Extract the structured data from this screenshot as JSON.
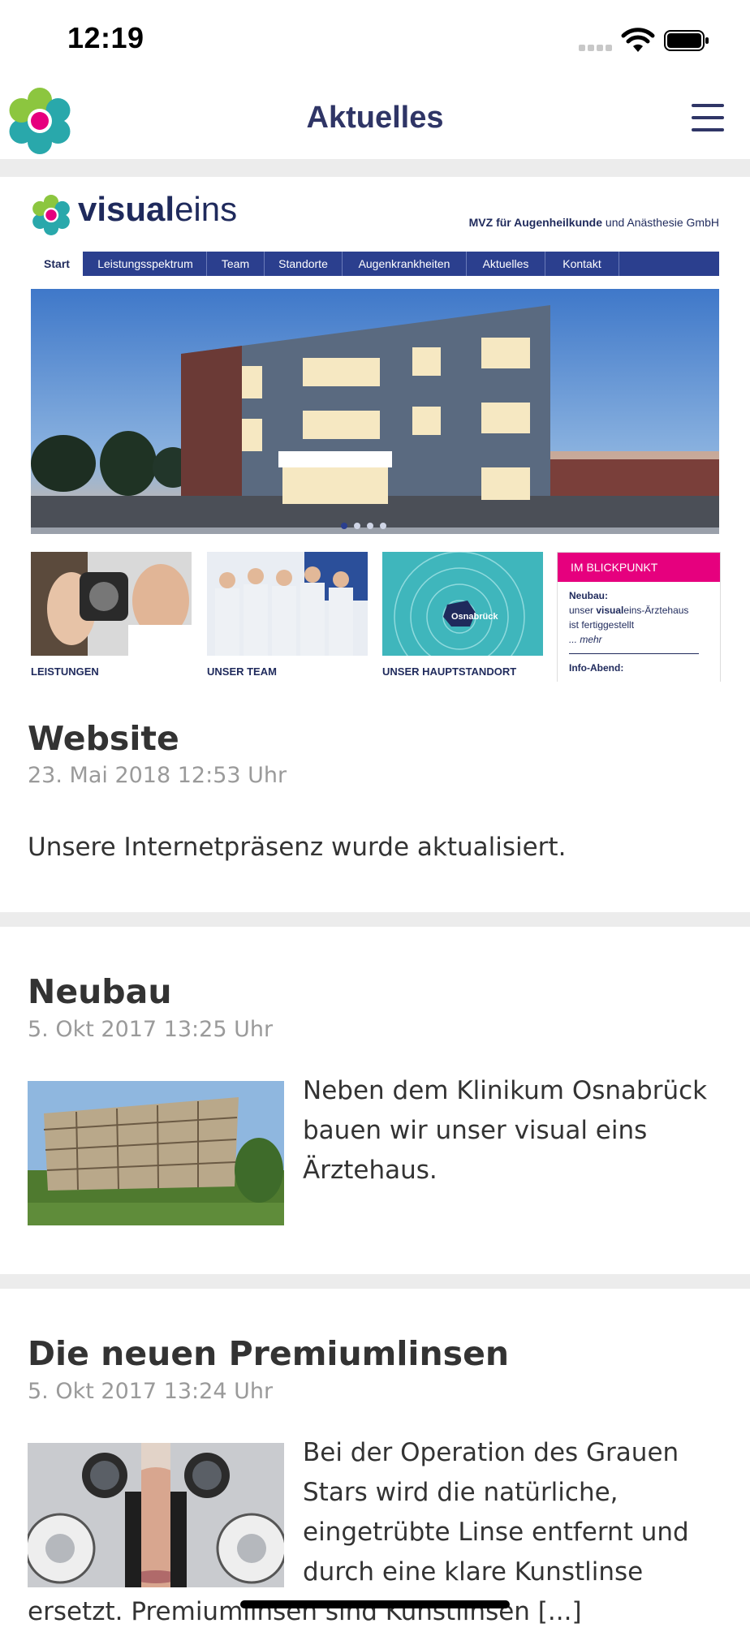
{
  "status_bar": {
    "time": "12:19"
  },
  "nav": {
    "title": "Aktuelles"
  },
  "website_preview": {
    "brand_bold": "visual",
    "brand_light": "eins",
    "tagline_bold": "MVZ für Augenheilkunde",
    "tagline_rest": " und Anästhesie GmbH",
    "menu": [
      "Start",
      "Leistungsspektrum",
      "Team",
      "Standorte",
      "Augenkrankheiten",
      "Aktuelles",
      "Kontakt"
    ],
    "tiles": [
      "LEISTUNGEN",
      "UNSER TEAM",
      "UNSER HAUPTSTANDORT"
    ],
    "map_city": "Osnabrück",
    "blickpunkt": {
      "header": "IM BLICKPUNKT",
      "item1_title": "Neubau:",
      "item1_line1_pre": "unser ",
      "item1_line1_bold": "visual",
      "item1_line1_post": "eins-Ärztehaus",
      "item1_line2": "ist fertiggestellt",
      "item1_more": "... mehr",
      "item2_title": "Info-Abend:"
    }
  },
  "news": [
    {
      "title": "Website",
      "date": "23. Mai 2018 12:53 Uhr",
      "text": "Unsere Internetpräsenz wurde aktualisiert."
    },
    {
      "title": "Neubau",
      "date": "5. Okt 2017 13:25 Uhr",
      "text_lines": [
        "Neben dem Klinikum Osnabrück",
        "bauen wir unser visual eins",
        "Ärztehaus."
      ]
    },
    {
      "title": "Die neuen Premiumlinsen",
      "date": "5. Okt 2017 13:24 Uhr",
      "text_lines": [
        "Bei der Operation des Grauen",
        "Stars wird die natürliche,",
        "eingetrübte Linse entfernt und",
        "durch eine klare Kunstlinse"
      ],
      "text_full_line": "ersetzt. Premiumlinsen sind Kunstlinsen [...]"
    }
  ],
  "colors": {
    "nav_title": "#2f3566",
    "separator": "#ececec",
    "site_nav": "#2b3f8e",
    "accent_pink": "#e6007e"
  }
}
